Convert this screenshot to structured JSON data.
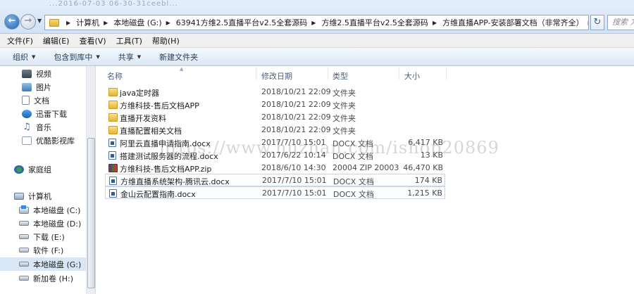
{
  "address_bar": {
    "ghost_text": "...2016-07-03 06-30-31ceebl...",
    "breadcrumbs": [
      "计算机",
      "本地磁盘 (G:)",
      "63941方维2.5直播平台v2.5全套源码",
      "方维2.5直播平台v2.5全套源码",
      "方维直播APP-安装部署文档（非常齐全）"
    ],
    "search_placeholder": "搜索 方维"
  },
  "menu": [
    "文件(F)",
    "编辑(E)",
    "查看(V)",
    "工具(T)",
    "帮助(H)"
  ],
  "toolbar": {
    "organize": "组织",
    "include_in_library": "包含到库中",
    "share": "共享",
    "new_folder": "新建文件夹"
  },
  "navigation": [
    {
      "label": "视频",
      "icon": "video-icon"
    },
    {
      "label": "图片",
      "icon": "picture-icon"
    },
    {
      "label": "文档",
      "icon": "document-icon"
    },
    {
      "label": "迅雷下载",
      "icon": "thunder-icon"
    },
    {
      "label": "音乐",
      "icon": "music-icon"
    },
    {
      "label": "优酷影视库",
      "icon": "youku-icon"
    },
    {
      "label": "家庭组",
      "icon": "homegroup-icon"
    },
    {
      "label": "计算机",
      "icon": "computer-icon"
    },
    {
      "label": "本地磁盘 (C:)",
      "icon": "system-drive-icon"
    },
    {
      "label": "本地磁盘 (D:)",
      "icon": "drive-icon"
    },
    {
      "label": "下载 (E:)",
      "icon": "drive-icon"
    },
    {
      "label": "软件 (F:)",
      "icon": "drive-icon"
    },
    {
      "label": "本地磁盘 (G:)",
      "icon": "drive-icon",
      "selected": true
    },
    {
      "label": "新加卷 (H:)",
      "icon": "drive-icon"
    }
  ],
  "columns": {
    "name": "名称",
    "date": "修改日期",
    "type": "类型",
    "size": "大小"
  },
  "files": [
    {
      "name": "java定时器",
      "date": "2018/10/21 22:09",
      "type": "文件夹",
      "size": "",
      "kind": "folder"
    },
    {
      "name": "方维科技-售后文档APP",
      "date": "2018/10/21 22:09",
      "type": "文件夹",
      "size": "",
      "kind": "folder"
    },
    {
      "name": "直播开发资料",
      "date": "2018/10/21 22:09",
      "type": "文件夹",
      "size": "",
      "kind": "folder"
    },
    {
      "name": "直播配置相关文档",
      "date": "2018/10/21 22:09",
      "type": "文件夹",
      "size": "",
      "kind": "folder"
    },
    {
      "name": "阿里云直播申请指南.docx",
      "date": "2017/7/10 15:01",
      "type": "DOCX 文档",
      "size": "6,417 KB",
      "kind": "docx"
    },
    {
      "name": "搭建测试服务器的流程.docx",
      "date": "2017/6/22 10:14",
      "type": "DOCX 文档",
      "size": "13 KB",
      "kind": "docx"
    },
    {
      "name": "方维科技-售后文档APP.zip",
      "date": "2018/6/10 14:30",
      "type": "20004 ZIP 20003",
      "size": "46,470 KB",
      "kind": "zip"
    },
    {
      "name": "方维直播系统架构-腾讯云.docx",
      "date": "2017/7/10 15:01",
      "type": "DOCX 文档",
      "size": "174 KB",
      "kind": "docx"
    },
    {
      "name": "金山云配置指南.docx",
      "date": "2017/7/10 15:01",
      "type": "DOCX 文档",
      "size": "1,215 KB",
      "kind": "docx"
    }
  ],
  "watermark": "https://www.huzhan.com/ishop20869"
}
